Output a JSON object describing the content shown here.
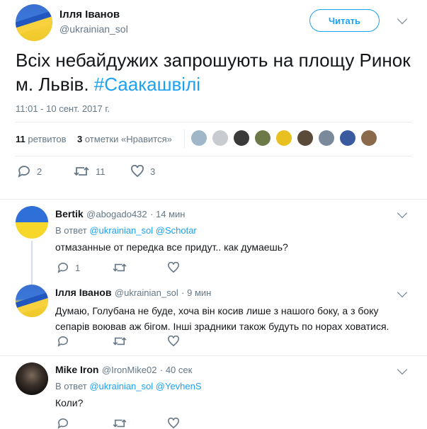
{
  "main_tweet": {
    "author_name": "Ілля Іванов",
    "author_handle": "@ukrainian_sol",
    "follow_label": "Читать",
    "text_before": "Всіх небайдужих запрошують на площу Ринок м. Львів. ",
    "hashtag": "#Саакашвілі",
    "timestamp": "11:01 - 10 сент. 2017 г.",
    "retweets_count": "11",
    "retweets_label": "ретвитов",
    "likes_count": "3",
    "likes_label": "отметки «Нравится»",
    "actions": {
      "replies": "2",
      "retweets": "11",
      "likes": "3"
    },
    "liker_colors": [
      "#9fb7c9",
      "#c8ccd0",
      "#3a3a3a",
      "#6c7a4a",
      "#e8c020",
      "#5a4a3a",
      "#7a8a9a",
      "#3a5aa0",
      "#8a6a4a"
    ]
  },
  "replies": [
    {
      "author_name": "Bertik",
      "author_handle": "@abogado432",
      "time": "· 14 мин",
      "reply_prefix": "В ответ",
      "reply_to_1": "@ukrainian_sol",
      "reply_to_2": "@Schotar",
      "text": "отмазанные от передка все придут.. как думаешь?",
      "reply_count": "1"
    },
    {
      "author_name": "Ілля Іванов",
      "author_handle": "@ukrainian_sol",
      "time": "· 9 мин",
      "text": "Думаю, Голубана не буде, хоча він косив лише з нашого боку, а з боку сепарів воював аж бігом. Інші зрадники також будуть по норах ховатися."
    },
    {
      "author_name": "Mike Iron",
      "author_handle": "@IronMike02",
      "time": "· 40 сек",
      "reply_prefix": "В ответ",
      "reply_to_1": "@ukrainian_sol",
      "reply_to_2": "@YevhenS",
      "text": "Коли?"
    }
  ],
  "colors": {
    "accent": "#1da1f2",
    "muted": "#657786",
    "text": "#14171a",
    "divider": "#e6ecf0"
  }
}
